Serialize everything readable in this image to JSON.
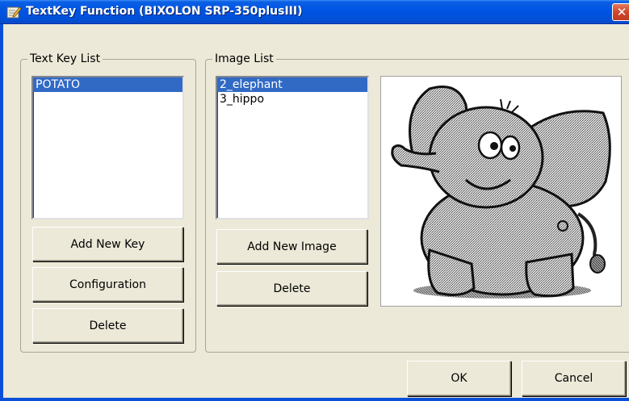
{
  "window": {
    "title": "TextKey Function (BIXOLON SRP-350plusIII)",
    "close_symbol": "✕",
    "icon": "app-pencil-icon"
  },
  "text_key_group": {
    "label": "Text Key List",
    "items": [
      {
        "label": "POTATO",
        "selected": true
      }
    ],
    "buttons": {
      "add_new_key": "Add New Key",
      "configuration": "Configuration",
      "delete": "Delete"
    }
  },
  "image_group": {
    "label": "Image List",
    "items": [
      {
        "label": "2_elephant",
        "selected": true
      },
      {
        "label": "3_hippo",
        "selected": false
      }
    ],
    "buttons": {
      "add_new_image": "Add New Image",
      "delete": "Delete"
    },
    "preview_image": "elephant-cartoon"
  },
  "footer": {
    "ok": "OK",
    "cancel": "Cancel"
  },
  "colors": {
    "titlebar": "#0054e3",
    "selection": "#316ac5",
    "dialog_bg": "#ece9d8"
  }
}
